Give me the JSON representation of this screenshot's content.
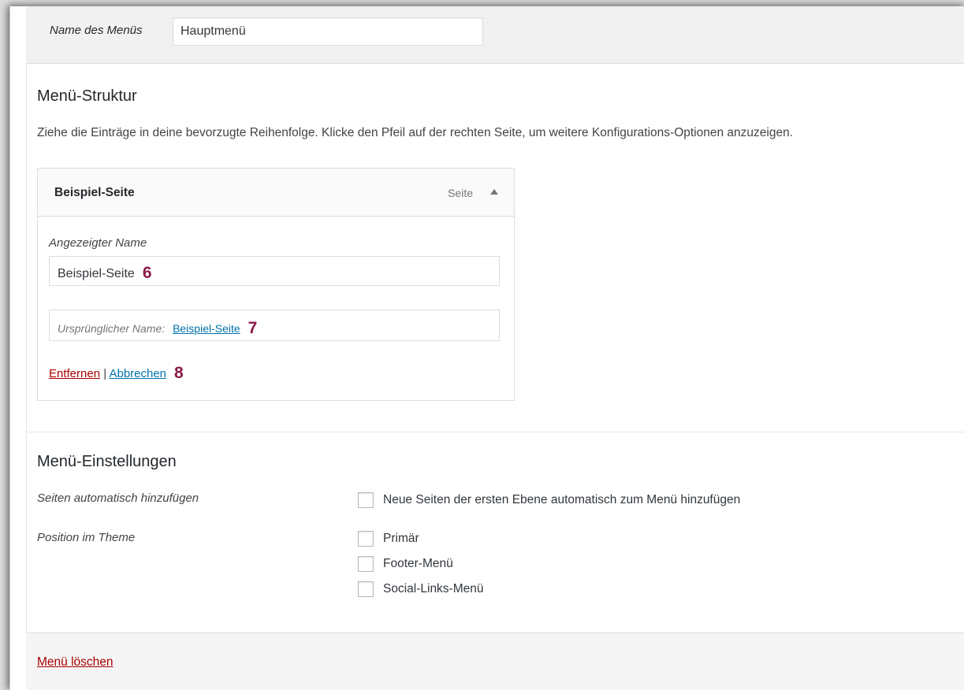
{
  "menu_name": {
    "label": "Name des Menüs",
    "value": "Hauptmenü"
  },
  "structure": {
    "title": "Menü-Struktur",
    "description": "Ziehe die Einträge in deine bevorzugte Reihenfolge. Klicke den Pfeil auf der rechten Seite, um weitere Konfigurations-Optionen anzuzeigen.",
    "item": {
      "title": "Beispiel-Seite",
      "type": "Seite",
      "toggle_icon": "triangle-up-icon",
      "nav_label_label": "Angezeigter Name",
      "nav_label_value": "Beispiel-Seite",
      "nav_label_marker": "6",
      "original_label": "Ursprünglicher Name:",
      "original_link": "Beispiel-Seite",
      "original_marker": "7",
      "remove_label": "Entfernen",
      "separator": "|",
      "cancel_label": "Abbrechen",
      "actions_marker": "8"
    }
  },
  "settings": {
    "title": "Menü-Einstellungen",
    "auto_add_label": "Seiten automatisch hinzufügen",
    "auto_add_option": "Neue Seiten der ersten Ebene automatisch zum Menü hinzufügen",
    "position_label": "Position im Theme",
    "locations": [
      "Primär",
      "Footer-Menü",
      "Social-Links-Menü"
    ]
  },
  "footer": {
    "delete_label": "Menü löschen"
  },
  "colors": {
    "link": "#0073aa",
    "delete": "#aa0000",
    "marker": "#8b1a4a"
  }
}
